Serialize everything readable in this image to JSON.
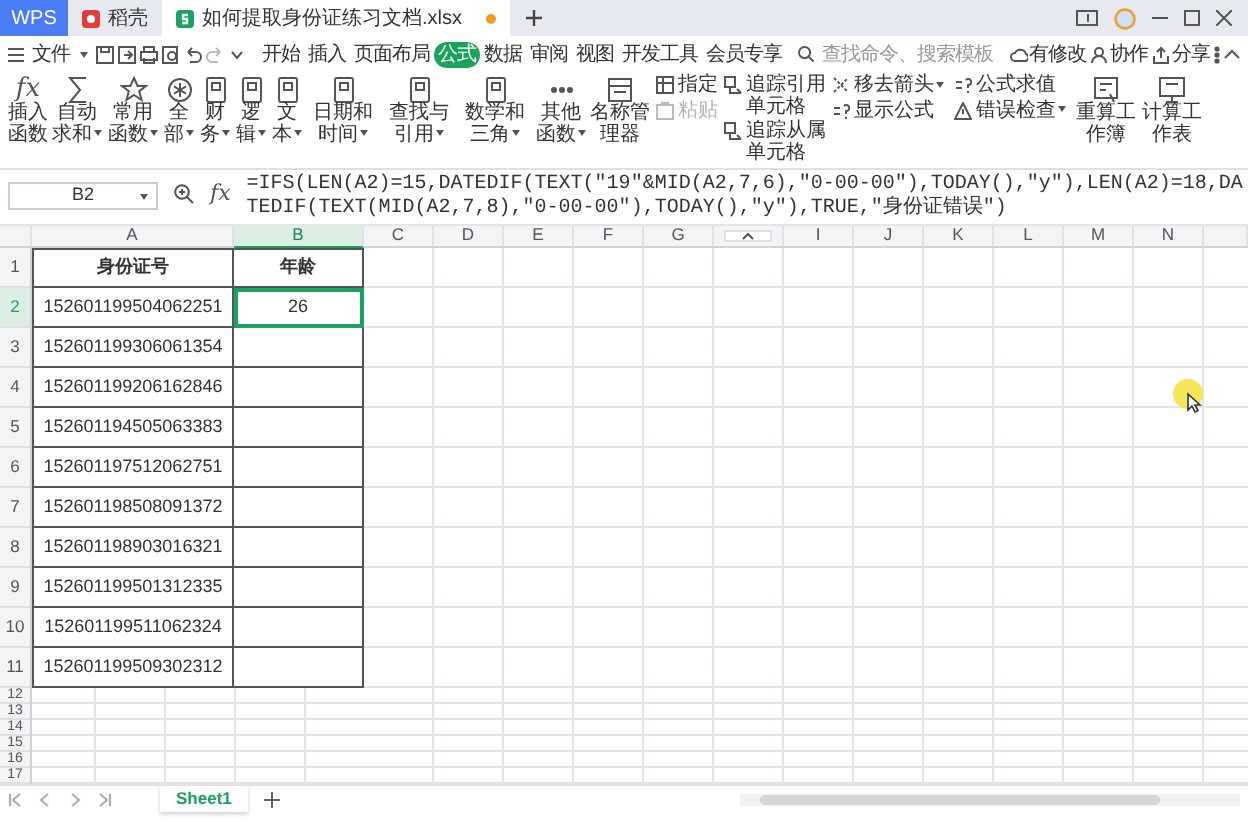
{
  "tabs": [
    {
      "label": "WPS",
      "kind": "app",
      "selected": false
    },
    {
      "label": "稻壳",
      "kind": "store",
      "selected": false
    },
    {
      "label": "如何提取身份证练习文档.xlsx",
      "kind": "file",
      "selected": true,
      "unsaved": true
    }
  ],
  "menu": {
    "file": "文件",
    "tabs": [
      {
        "label": "开始",
        "selected": false
      },
      {
        "label": "插入",
        "selected": false
      },
      {
        "label": "页面布局",
        "selected": false
      },
      {
        "label": "公式",
        "selected": true
      },
      {
        "label": "数据",
        "selected": false
      },
      {
        "label": "审阅",
        "selected": false
      },
      {
        "label": "视图",
        "selected": false
      },
      {
        "label": "开发工具",
        "selected": false
      },
      {
        "label": "会员专享",
        "selected": false
      }
    ],
    "search": {
      "placeholder": "查找命令、搜索模板"
    },
    "actions": [
      "有修改",
      "协作",
      "分享"
    ]
  },
  "ribbon": {
    "functions": [
      {
        "label": "插入函数",
        "glyph": "fx",
        "dropdown": false
      },
      {
        "label": "自动求和",
        "dropdown": true
      },
      {
        "label": "常用函数",
        "dropdown": true
      },
      {
        "label": "全部",
        "dropdown": true
      },
      {
        "label": "财务",
        "dropdown": true
      },
      {
        "label": "逻辑",
        "dropdown": true
      },
      {
        "label": "文本",
        "dropdown": true
      },
      {
        "label": "日期和时间",
        "dropdown": true
      },
      {
        "label": "查找与引用",
        "dropdown": true
      },
      {
        "label": "数学和三角",
        "dropdown": true
      },
      {
        "label": "其他函数",
        "dropdown": true
      },
      {
        "label": "名称管理器",
        "dropdown": false
      }
    ],
    "stacked": [
      [
        {
          "label": "指定",
          "disabled": false,
          "dropdown": false
        },
        {
          "label": "粘贴",
          "disabled": true,
          "dropdown": false
        }
      ],
      [
        {
          "label": "追踪引用单元格",
          "disabled": false,
          "dropdown": false
        },
        {
          "label": "追踪从属单元格",
          "disabled": false,
          "dropdown": false
        }
      ],
      [
        {
          "label": "移去箭头",
          "disabled": false,
          "dropdown": true
        },
        {
          "label": "显示公式",
          "disabled": false,
          "dropdown": false
        }
      ],
      [
        {
          "label": "公式求值",
          "disabled": false,
          "dropdown": false
        },
        {
          "label": "错误检查",
          "disabled": false,
          "dropdown": true
        }
      ]
    ],
    "calc": [
      {
        "label": "重算工作簿"
      },
      {
        "label": "计算工作表"
      }
    ]
  },
  "formula_bar": {
    "name_box": "B2",
    "fx": "fx",
    "formula": "=IFS(LEN(A2)=15,DATEDIF(TEXT(\"19\"&MID(A2,7,6),\"0-00-00\"),TODAY(),\"y\"),LEN(A2)=18,DATEDIF(TEXT(MID(A2,7,8),\"0-00-00\"),TODAY(),\"y\"),TRUE,\"身份证错误\")"
  },
  "columns": [
    {
      "kind": "letter",
      "label": "A",
      "selected": false
    },
    {
      "kind": "letter",
      "label": "B",
      "selected": true
    },
    {
      "kind": "letter",
      "label": "C",
      "selected": false
    },
    {
      "kind": "letter",
      "label": "D",
      "selected": false
    },
    {
      "kind": "letter",
      "label": "E",
      "selected": false
    },
    {
      "kind": "letter",
      "label": "F",
      "selected": false
    },
    {
      "kind": "letter",
      "label": "G",
      "selected": false
    },
    {
      "kind": "handle",
      "selected": false
    },
    {
      "kind": "letter",
      "label": "I",
      "selected": false
    },
    {
      "kind": "letter",
      "label": "J",
      "selected": false
    },
    {
      "kind": "letter",
      "label": "K",
      "selected": false
    },
    {
      "kind": "letter",
      "label": "L",
      "selected": false
    },
    {
      "kind": "letter",
      "label": "M",
      "selected": false
    },
    {
      "kind": "letter",
      "label": "N",
      "selected": false
    }
  ],
  "rows": [
    {
      "number": "1",
      "kind": "header",
      "selected": false,
      "cells": [
        "身份证号",
        "年龄"
      ]
    },
    {
      "number": "2",
      "kind": "data",
      "selected": true,
      "cells": [
        "152601199504062251",
        "26"
      ]
    },
    {
      "number": "3",
      "kind": "data",
      "selected": false,
      "cells": [
        "152601199306061354"
      ]
    },
    {
      "number": "4",
      "kind": "data",
      "selected": false,
      "cells": [
        "152601199206162846"
      ]
    },
    {
      "number": "5",
      "kind": "data",
      "selected": false,
      "cells": [
        "152601194505063383"
      ]
    },
    {
      "number": "6",
      "kind": "data",
      "selected": false,
      "cells": [
        "152601197512062751"
      ]
    },
    {
      "number": "7",
      "kind": "data",
      "selected": false,
      "cells": [
        "152601198508091372"
      ]
    },
    {
      "number": "8",
      "kind": "data",
      "selected": false,
      "cells": [
        "152601198903016321"
      ]
    },
    {
      "number": "9",
      "kind": "data",
      "selected": false,
      "cells": [
        "152601199501312335"
      ]
    },
    {
      "number": "10",
      "kind": "data",
      "selected": false,
      "cells": [
        "152601199511062324"
      ]
    },
    {
      "number": "11",
      "kind": "data",
      "selected": false,
      "cells": [
        "152601199509302312"
      ]
    }
  ],
  "empty_rows": [
    "12",
    "13",
    "14",
    "15",
    "16",
    "17"
  ],
  "sheets": [
    {
      "label": "Sheet1",
      "selected": true
    }
  ]
}
